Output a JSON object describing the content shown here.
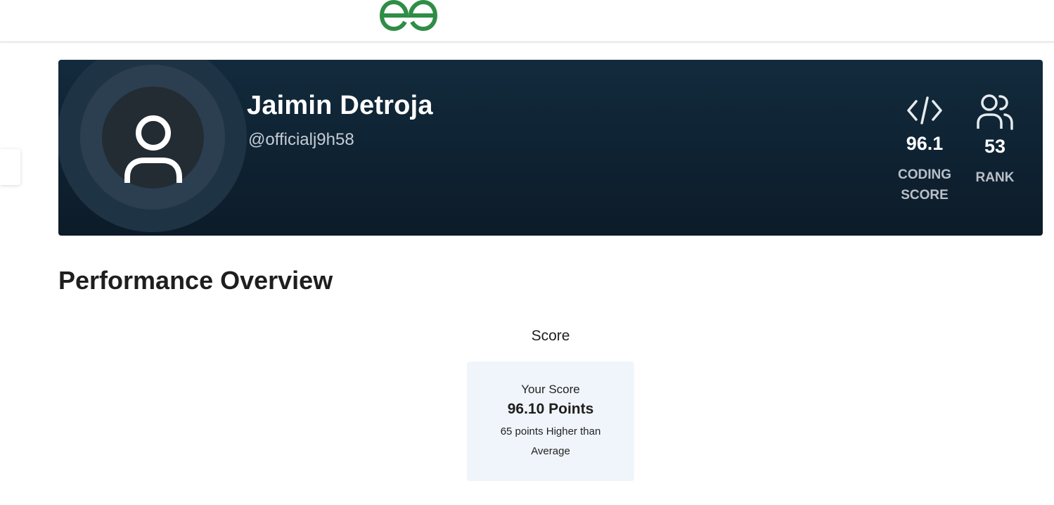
{
  "brand": {
    "logo": "gfg-logo",
    "color": "#2f8d46"
  },
  "profile": {
    "name": "Jaimin Detroja",
    "handle": "@officialj9h58",
    "avatar_icon": "user-icon"
  },
  "stats": {
    "coding_score": {
      "icon": "code-icon",
      "value": "96.1",
      "label_line1": "CODING",
      "label_line2": "SCORE"
    },
    "rank": {
      "icon": "users-icon",
      "value": "53",
      "label": "RANK"
    }
  },
  "performance": {
    "title": "Performance Overview",
    "score_heading": "Score",
    "card": {
      "label": "Your Score",
      "value": "96.10 Points",
      "note": "65 points Higher than Average"
    }
  },
  "colors": {
    "banner_top": "#122b3c",
    "banner_bottom": "#0d1b28",
    "card_bg": "#f0f5fb"
  }
}
